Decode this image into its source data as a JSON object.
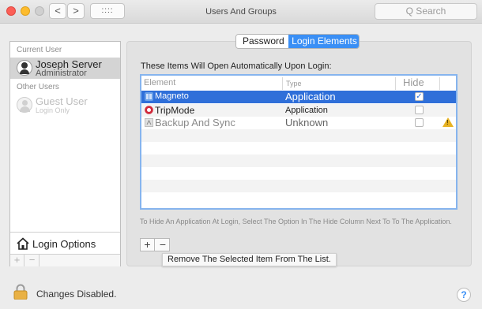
{
  "window": {
    "title": "Users And Groups",
    "search_placeholder": "Q Search",
    "back_glyph": "<",
    "forward_glyph": ">",
    "grid_glyph": "::::"
  },
  "users_panel": {
    "current_user_label": "Current User",
    "current_user": {
      "name": "Joseph Server",
      "role": "Administrator"
    },
    "other_users_label": "Other Users",
    "other_users": [
      {
        "name": "Guest User",
        "role": "Login Only"
      }
    ],
    "login_options_label": "Login Options",
    "add_glyph": "+",
    "remove_glyph": "−"
  },
  "tabs": {
    "left_label": "Password",
    "right_label": "Login Elements",
    "selected": "Login Elements"
  },
  "login_items": {
    "heading": "These Items Will Open Automatically Upon Login:",
    "columns": {
      "element": "Element",
      "type": "Type",
      "hide": "Hide"
    },
    "rows": [
      {
        "name": "Magneto",
        "type": "Application",
        "hide": true,
        "icon": "magnet-app-icon",
        "selected": true,
        "warning": false
      },
      {
        "name": "TripMode",
        "type": "Application",
        "hide": false,
        "icon": "tripmode-app-icon",
        "selected": false,
        "warning": false
      },
      {
        "name": "Backup And Sync",
        "type": "Unknown",
        "hide": false,
        "icon": "generic-app-icon",
        "selected": false,
        "warning": true
      }
    ],
    "hint": "To Hide An Application At Login, Select The Option In The Hide Column Next To To The Application.",
    "add_glyph": "+",
    "remove_glyph": "−",
    "tooltip": "Remove The Selected Item From The List."
  },
  "footer": {
    "lock_label": "Changes Disabled.",
    "help_glyph": "?"
  },
  "colors": {
    "accent": "#3a8ff5",
    "selection": "#2f6fd9",
    "warning": "#e8b323"
  }
}
